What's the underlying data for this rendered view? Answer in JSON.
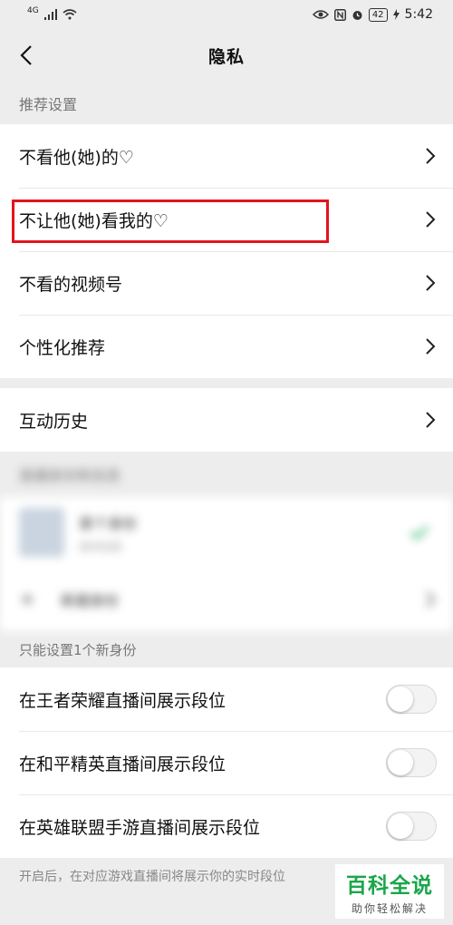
{
  "status_bar": {
    "network": "4G",
    "battery": "42",
    "time": "5:42"
  },
  "nav": {
    "title": "隐私"
  },
  "recommend_section": {
    "label": "推荐设置"
  },
  "recommend_items": [
    {
      "label": "不看他(她)的♡"
    },
    {
      "label": "不让他(她)看我的♡"
    },
    {
      "label": "不看的视频号"
    },
    {
      "label": "个性化推荐"
    }
  ],
  "interaction": {
    "label": "互动历史"
  },
  "blurred": {
    "section_label": "直播身份和信息",
    "identity_name": "某个身份",
    "identity_sub": "身份信息",
    "create_label": "新建身份"
  },
  "identity_section": {
    "label": "只能设置1个新身份"
  },
  "rank_items": [
    {
      "label": "在王者荣耀直播间展示段位",
      "on": false
    },
    {
      "label": "在和平精英直播间展示段位",
      "on": false
    },
    {
      "label": "在英雄联盟手游直播间展示段位",
      "on": false
    }
  ],
  "footnote": "开启后，在对应游戏直播间将展示你的实时段位",
  "watermark": {
    "main": "百科全说",
    "sub": "助你轻松解决"
  },
  "colors": {
    "highlight": "#e3141b",
    "watermark": "#1aa64a"
  }
}
